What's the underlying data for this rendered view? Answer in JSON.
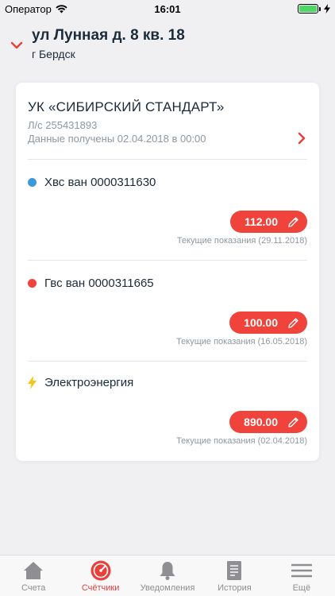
{
  "status_bar": {
    "carrier": "Оператор",
    "time": "16:01"
  },
  "header": {
    "address": "ул Лунная д. 8 кв. 18",
    "city": "г Бердск"
  },
  "company": {
    "name": "УК «СИБИРСКИЙ СТАНДАРТ»",
    "account": "Л/с 255431893",
    "data_received": "Данные получены 02.04.2018 в 00:00"
  },
  "meters": [
    {
      "name": "Хвс ван 0000311630",
      "reading": "112.00",
      "caption": "Текущие показания (29.11.2018)",
      "color": "#3b9ad9"
    },
    {
      "name": "Гвс ван 0000311665",
      "reading": "100.00",
      "caption": "Текущие показания (16.05.2018)",
      "color": "#f0433c"
    },
    {
      "name": "Электроэнергия",
      "reading": "890.00",
      "caption": "Текущие показания (02.04.2018)",
      "color": "#f5c518"
    }
  ],
  "tabs": [
    {
      "label": "Счета",
      "icon": "home-icon"
    },
    {
      "label": "Счётчики",
      "icon": "gauge-icon",
      "active": true
    },
    {
      "label": "Уведомления",
      "icon": "bell-icon"
    },
    {
      "label": "История",
      "icon": "document-icon"
    },
    {
      "label": "Ещё",
      "icon": "menu-icon"
    }
  ],
  "colors": {
    "accent": "#f0433c",
    "text": "#1c2b3a",
    "muted": "#8e97a0"
  }
}
